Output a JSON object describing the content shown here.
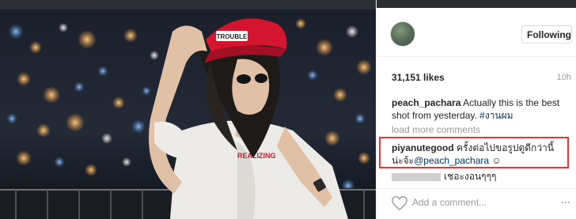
{
  "header": {
    "username_avatar": "avatar",
    "follow_label": "Following"
  },
  "post": {
    "likes": "31,151 likes",
    "time": "10h",
    "caption": {
      "user": "peach_pachara",
      "text": " Actually this is the best shot from yesterday. ",
      "hashtag": "#งานผม"
    },
    "cap_text": "TROUBLE",
    "shirt_text": "REALIZING"
  },
  "comments": {
    "load_more": "load more comments",
    "items": [
      {
        "user": "piyanutegood",
        "text": " ครั้งต่อไปขอรูปดูดีกว่านี้น่ะจ้ะ",
        "mention": "@peach_pachara",
        "emoji": "☺"
      },
      {
        "user": "",
        "text": "เชอะงอนๆๆๆ"
      }
    ]
  },
  "composer": {
    "placeholder": "Add a comment...",
    "more": "···"
  },
  "colors": {
    "highlight": "#e53935",
    "link": "#003569",
    "cap": "#d3152f",
    "text": "#262626",
    "muted": "#999999"
  },
  "icons": {
    "heart": "heart-icon",
    "more": "more-icon"
  }
}
